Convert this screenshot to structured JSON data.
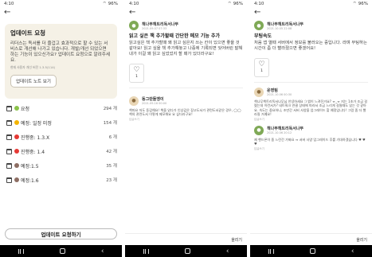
{
  "status_time": "4:10",
  "status_battery": "96%",
  "panel1": {
    "card_title": "업데이트 요청",
    "card_desc": "리더스는 독서를 더 즐겁고 효과적으로 할 수 있는 서비스로 개선해 나가고 있습니다. 개발/개선 되었으면 하는 기능이 있으신가요? 업데이트 요청으로 알려주세요.",
    "card_note": "현재 사용자 개선 버전 1.3.5(114)",
    "notes_button": "업데이트 노트 보기",
    "stats": [
      {
        "label": "요청",
        "count": "294 개",
        "color": "#8bc34a"
      },
      {
        "label": "예정: 일정 미정",
        "count": "154 개",
        "color": "#f4b400"
      },
      {
        "label": "진행중: 1.3.X",
        "count": "6 개",
        "color": "#e53935"
      },
      {
        "label": "진행중: 1.4",
        "count": "42 개",
        "color": "#e53935"
      },
      {
        "label": "예정:1.5",
        "count": "35 개",
        "color": "#8d6e63"
      },
      {
        "label": "예정:1.6",
        "count": "23 개",
        "color": "#8d6e63"
      }
    ],
    "request_button": "업데이트 요청하기"
  },
  "panel2": {
    "author": "책나무책트리독서나무",
    "date": "2021.09.07 07:33",
    "title": "읽고 싶은 책 추가할때 간단한 메모 기능 추가",
    "body": "읽고싶은 책 추가할때 왜 읽고 싶은지 쓰는 칸이 있으면 좋을 것 같아요! 읽고 싶을 책 추가해놓고 나중에 기록되면 잊어버린 말해 내가 이걸 왜 읽고 싶었었지 할 때가 있더라구요!",
    "like_count": "1",
    "commenter": "동그란돌멩이",
    "comment_date": "2021.09.16 00:00",
    "comment_text": "책마요 저도 동감해요! 책을 읽다가 인상깊은 장고도서가 관련도서같은 경우, ◯◯ 책의 관련도서 이렇게 메모해요 요 싶더라구요!",
    "comment_meta": "답글쓰기",
    "comment_action": "올리기"
  },
  "panel3": {
    "author": "책나무책트리독서나무",
    "date": "2021.10.05 22:08",
    "title": "부팅속도",
    "body": "처음 앱 열때 서버에서 정보를 불러오는 중입니다. 라며 부팅하는 시간이 좀 더 빨라졌으면 좋겠어요!",
    "like_count": "1",
    "reply1_author": "운영팀",
    "reply1_date": "2021.10.06 00:30",
    "reply1_text": "책나무책트리독서나무님 안녕하세요 :) 앱이 느려진거요? ㅠ_ㅠ 지는 1초가 조금 걸렸는데 이런서가? 네트워크 연결 상태에 따라서 조금 느리게 걸릴때도 있는 것 같아요. 속도는 중요하니, 조만간 서버 사양을 업그레이드 할 예정입니다! 그럼 좀 더 빨라질 거예요!",
    "reply1_meta": "답글쓰기",
    "reply2_author": "책나무책트리독서나무",
    "reply2_date": "2021.10.06 20:12",
    "reply2_text": "제 핸드폰이 좀 느린건 가봐요 ㅠ 서버 사양 업그레이드 후를 기대하겠습니다 ♥ ♥ ♥",
    "reply2_meta": "답글쓰기",
    "comment_action": "올리기"
  }
}
